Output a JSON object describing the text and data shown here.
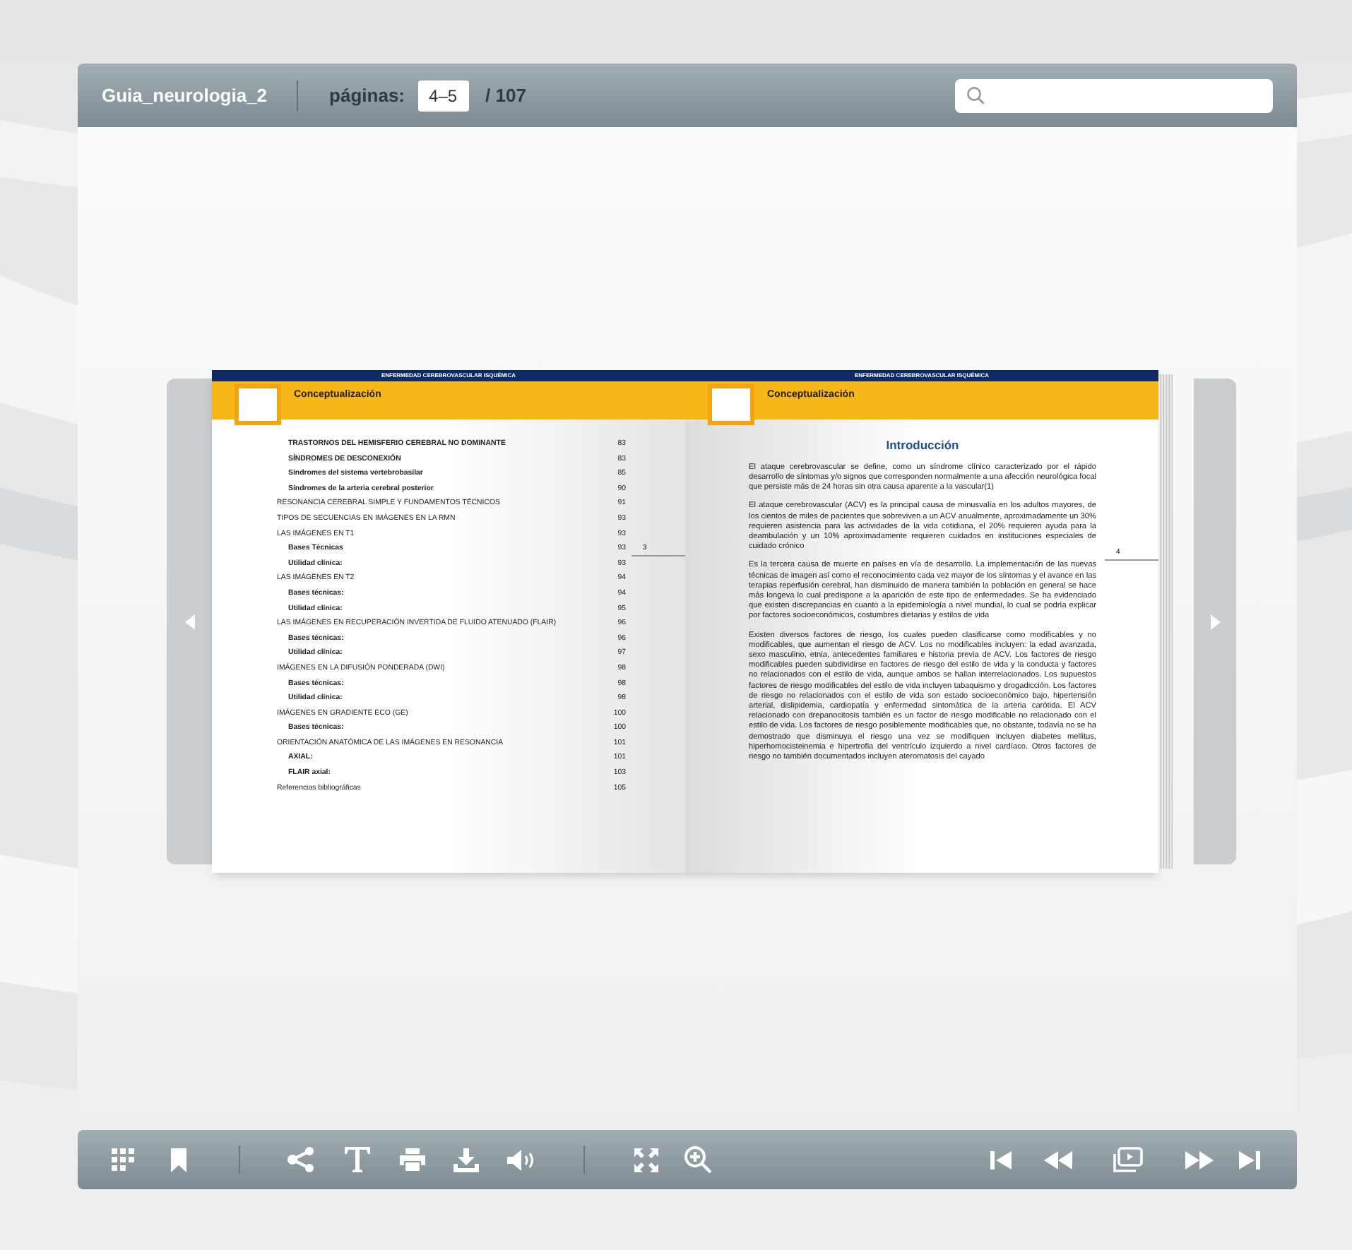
{
  "viewer": {
    "title": "Guia_neurologia_2",
    "pages_label": "páginas:",
    "pages_value": "4–5",
    "pages_total": "/ 107"
  },
  "book": {
    "left_page": {
      "running_head": "ENFERMEDAD CEREBROVASCULAR ISQUÉMICA",
      "section": "Conceptualización",
      "page_number": "3",
      "toc": [
        {
          "children": [
            {
              "title": "TRASTORNOS DEL HEMISFERIO CEREBRAL NO DOMINANTE",
              "page": "83"
            },
            {
              "title": "SÍNDROMES DE DESCONEXIÓN",
              "page": "83"
            },
            {
              "title": "Síndromes del sistema vertebrobasilar",
              "page": "85"
            },
            {
              "title": "Síndromes de la arteria cerebral posterior",
              "page": "90"
            }
          ]
        },
        {
          "title": "RESONANCIA CEREBRAL SIMPLE Y FUNDAMENTOS TÉCNICOS",
          "page": "91"
        },
        {
          "title": "TIPOS DE SECUENCIAS EN  IMÁGENES EN LA  RMN",
          "page": "93"
        },
        {
          "title": "LAS IMÁGENES EN T1",
          "page": "93",
          "children": [
            {
              "title": "Bases Técnicas",
              "page": "93"
            },
            {
              "title": "Utilidad clínica:",
              "page": "93"
            }
          ]
        },
        {
          "title": "LAS IMÁGENES EN  T2",
          "page": "94",
          "children": [
            {
              "title": "Bases técnicas:",
              "page": "94"
            },
            {
              "title": "Utilidad clínica:",
              "page": "95"
            }
          ]
        },
        {
          "title": "LAS IMÁGENES EN RECUPERACIÓN INVERTIDA DE FLUIDO ATENUADO (FLAIR)",
          "page": "96",
          "children": [
            {
              "title": "Bases técnicas:",
              "page": "96"
            },
            {
              "title": "Utilidad clínica:",
              "page": "97"
            }
          ]
        },
        {
          "title": "IMÁGENES EN LA  DIFUSIÓN PONDERADA (DWI)",
          "page": "98",
          "children": [
            {
              "title": "Bases técnicas:",
              "page": "98"
            },
            {
              "title": "Utilidad clínica:",
              "page": "98"
            }
          ]
        },
        {
          "title": "IMÁGENES EN GRADIENTE ECO (GE)",
          "page": "100",
          "children": [
            {
              "title": "Bases técnicas:",
              "page": "100"
            }
          ]
        },
        {
          "title": "ORIENTACIÓN ANATÓMICA DE LAS IMÁGENES EN RESONANCIA",
          "page": "101",
          "children": [
            {
              "title": "AXIAL:",
              "page": "101"
            },
            {
              "title": "FLAIR  axial:",
              "page": "103"
            }
          ]
        },
        {
          "title": "Referencias bibliográficas",
          "page": "105"
        }
      ]
    },
    "right_page": {
      "running_head": "ENFERMEDAD CEREBROVASCULAR ISQUÉMICA",
      "section": "Conceptualización",
      "heading": "Introducción",
      "page_number": "4",
      "paragraphs": [
        "El ataque  cerebrovascular se define, como un síndrome clínico caracterizado por  el rápido desarrollo de síntomas y/o signos que corresponden normalmente a una afección neurológica focal que persiste más de 24 horas sin otra causa aparente a la vascular(1)",
        "El ataque cerebrovascular (ACV) es la principal causa de  minusvalía en los adultos mayores, de los cientos de miles de pacientes que sobreviven a un ACV anualmente, aproximadamente un 30% requieren asistencia para las actividades de la vida cotidiana, el 20% requieren ayuda para la deambulación y un 10% aproximadamente requieren cuidados en instituciones especiales de cuidado crónico",
        "Es la tercera causa de muerte en países en vía de desarrollo. La implementación de las nuevas técnicas de imagen así como el reconocimiento cada vez mayor de los síntomas y el avance en las terapias reperfusión cerebral, han disminuido de manera  también la población en general se hace más longeva lo cual predispone a la aparición de este tipo de enfermedades. Se ha evidenciado que existen discrepancias en cuanto a la epidemiología a nivel mundial, lo cual se podría explicar por factores socioeconómicos, costumbres dietarias y estilos de vida",
        "Existen diversos factores de riesgo, los cuales pueden clasificarse como modificables y no modificables, que aumentan el riesgo de ACV. Los no modificables incluyen: la edad avanzada, sexo masculino, etnia, antecedentes familiares e historia previa de ACV. Los factores de riesgo modificables pueden subdividirse en factores de riesgo del estilo de vida y la conducta y factores no relacionados  con el estilo de vida, aunque ambos se hallan  interrelacionados. Los supuestos factores de riesgo modificables del estilo de vida incluyen tabaquismo y drogadicción. Los factores de riesgo no relacionados con el estilo de vida son estado socioeconómico bajo, hipertensión arterial, dislipidemia, cardiopatía y enfermedad sintomática de la arteria carótida. El ACV relacionado con drepanocitosis también es un factor de riesgo modificable no relacionado con el estilo de vida. Los factores de riesgo posiblemente modificables que, no obstante, todavía no se ha demostrado que disminuya el riesgo una vez se modifiquen incluyen diabetes mellitus, hiperhomocisteinemia e hipertrofia del ventrículo izquierdo a nivel cardíaco.  Otros factores de riesgo no también documentados incluyen ateromatosis del cayado"
      ]
    }
  }
}
